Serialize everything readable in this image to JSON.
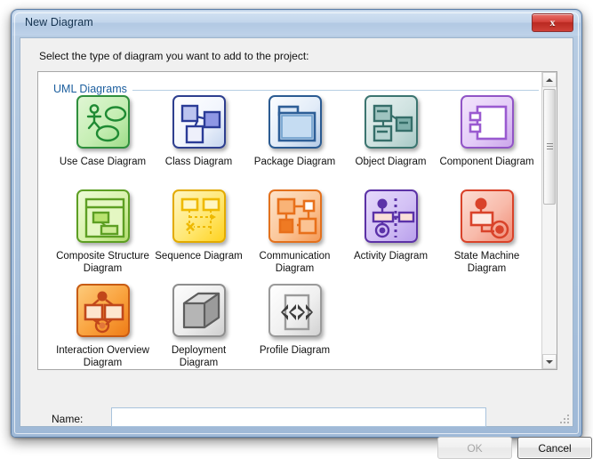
{
  "window": {
    "title": "New Diagram",
    "close_label": "x",
    "close_icon": "close-icon"
  },
  "content": {
    "instruction": "Select the type of diagram you want to add to the project:",
    "group_legend": "UML Diagrams"
  },
  "diagrams": [
    {
      "label": "Use Case Diagram",
      "icon": "use-case-diagram-icon",
      "color": "#3aa13a"
    },
    {
      "label": "Class Diagram",
      "icon": "class-diagram-icon",
      "color": "#3b4fa8"
    },
    {
      "label": "Package Diagram",
      "icon": "package-diagram-icon",
      "color": "#2f5f9e"
    },
    {
      "label": "Object Diagram",
      "icon": "object-diagram-icon",
      "color": "#3f7d77"
    },
    {
      "label": "Component Diagram",
      "icon": "component-diagram-icon",
      "color": "#a064c8"
    },
    {
      "label": "Composite Structure Diagram",
      "icon": "composite-structure-diagram-icon",
      "color": "#5da326"
    },
    {
      "label": "Sequence Diagram",
      "icon": "sequence-diagram-icon",
      "color": "#e0b400"
    },
    {
      "label": "Communication Diagram",
      "icon": "communication-diagram-icon",
      "color": "#e8712a"
    },
    {
      "label": "Activity Diagram",
      "icon": "activity-diagram-icon",
      "color": "#5b32a8"
    },
    {
      "label": "State Machine Diagram",
      "icon": "state-machine-diagram-icon",
      "color": "#d9432a"
    },
    {
      "label": "Interaction Overview Diagram",
      "icon": "interaction-overview-diagram-icon",
      "color": "#cf5a1a"
    },
    {
      "label": "Deployment Diagram",
      "icon": "deployment-diagram-icon",
      "color": "#8a8a8a"
    },
    {
      "label": "Profile Diagram",
      "icon": "profile-diagram-icon",
      "color": "#707070"
    }
  ],
  "form": {
    "name_label": "Name:",
    "name_value": "",
    "name_placeholder": ""
  },
  "footer": {
    "ok_label": "OK",
    "cancel_label": "Cancel"
  },
  "scrollbar": {
    "up_icon": "chevron-up-icon",
    "down_icon": "chevron-down-icon"
  }
}
